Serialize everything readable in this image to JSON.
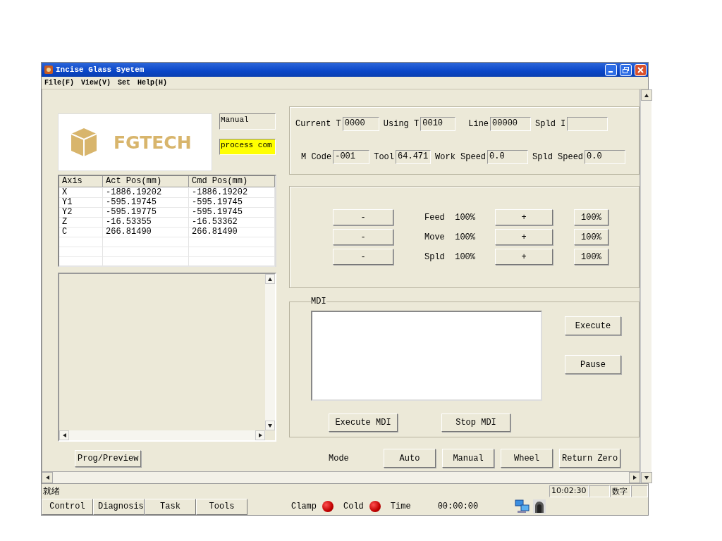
{
  "window": {
    "title": "Incise Glass Syetem"
  },
  "menu": [
    "File(F)",
    "View(V)",
    "Set",
    "Help(H)"
  ],
  "logo": {
    "text": "FGTECH"
  },
  "mode_display": "Manual",
  "process_display": "process com",
  "axis_table": {
    "columns": [
      "Axis",
      "Act Pos(mm)",
      "Cmd Pos(mm)"
    ],
    "rows": [
      [
        "X",
        "-1886.19202",
        "-1886.19202"
      ],
      [
        "Y1",
        "-595.19745",
        "-595.19745"
      ],
      [
        "Y2",
        "-595.19775",
        "-595.19745"
      ],
      [
        "Z",
        "-16.53355",
        "-16.53362"
      ],
      [
        "C",
        "266.81490",
        "266.81490"
      ]
    ]
  },
  "prog_preview_button": "Prog/Preview",
  "info_rows": [
    [
      {
        "label": "Current T",
        "value": "0000"
      },
      {
        "label": "Using T",
        "value": "0010"
      },
      {
        "label": "Line",
        "value": "00000"
      },
      {
        "label": "Spld I"
      }
    ],
    [
      {
        "label": "M Code",
        "value": "-001"
      },
      {
        "label": "Tool",
        "value": "64.471"
      },
      {
        "label": "Work Speed",
        "value": "0.0"
      },
      {
        "label": "Spld Speed",
        "value": "0.0"
      }
    ]
  ],
  "overrides": [
    {
      "minus": "-",
      "label": "Feed  100%",
      "plus": "+",
      "reset": "100%"
    },
    {
      "minus": "-",
      "label": "Move  100%",
      "plus": "+",
      "reset": "100%"
    },
    {
      "minus": "-",
      "label": "Spld  100%",
      "plus": "+",
      "reset": "100%"
    }
  ],
  "mdi": {
    "title": "MDI",
    "side_buttons": [
      "Execute",
      "Pause"
    ],
    "bottom_buttons": [
      "Execute MDI",
      "Stop MDI"
    ]
  },
  "mode": {
    "label": "Mode",
    "buttons": [
      "Auto",
      "Manual",
      "Wheel",
      "Return Zero"
    ]
  },
  "status_bar": {
    "message": "就绪",
    "time": "10:02:30",
    "mode": "数字"
  },
  "tabs": [
    "Control",
    "Diagnosis",
    "Task",
    "Tools"
  ],
  "lamps": [
    {
      "label": "Clamp",
      "on": true
    },
    {
      "label": "Cold",
      "on": true
    }
  ],
  "timer": {
    "label": "Time",
    "value": "00:00:00"
  }
}
